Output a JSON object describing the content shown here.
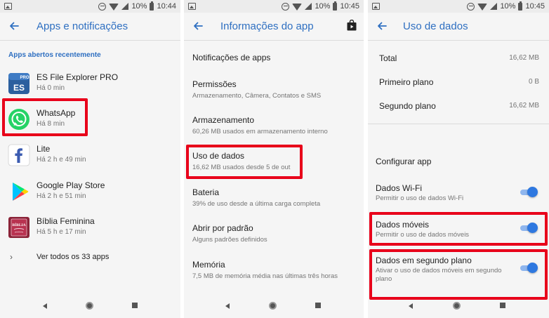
{
  "status_bar": {
    "screen1": {
      "battery": "10%",
      "time": "10:44"
    },
    "screen2": {
      "battery": "10%",
      "time": "10:45"
    },
    "screen3": {
      "battery": "10%",
      "time": "10:45"
    }
  },
  "screen1": {
    "title": "Apps e notificações",
    "section_header": "Apps abertos recentemente",
    "apps": [
      {
        "name": "ES File Explorer PRO",
        "time": "Há 0 min",
        "icon": "es-file-explorer-icon"
      },
      {
        "name": "WhatsApp",
        "time": "Há 8 min",
        "icon": "whatsapp-icon"
      },
      {
        "name": "Lite",
        "time": "Há 2 h e 49 min",
        "icon": "facebook-lite-icon"
      },
      {
        "name": "Google Play Store",
        "time": "Há 2 h e 51 min",
        "icon": "play-store-icon"
      },
      {
        "name": "Bíblia Feminina",
        "time": "Há 5 h e 17 min",
        "icon": "biblia-feminina-icon"
      }
    ],
    "see_all": "Ver todos os 33 apps",
    "icon_labels": {
      "es": "ES",
      "es_pro": "PRO",
      "biblia": "BÍBLIA"
    }
  },
  "screen2": {
    "title": "Informações do app",
    "items": [
      {
        "title": "Notificações de apps",
        "subtitle": ""
      },
      {
        "title": "Permissões",
        "subtitle": "Armazenamento, Câmera, Contatos e SMS"
      },
      {
        "title": "Armazenamento",
        "subtitle": "60,26 MB usados em armazenamento interno"
      },
      {
        "title": "Uso de dados",
        "subtitle": "16,62 MB usados desde 5 de out"
      },
      {
        "title": "Bateria",
        "subtitle": "39% de uso desde a última carga completa"
      },
      {
        "title": "Abrir por padrão",
        "subtitle": "Alguns padrões definidos"
      },
      {
        "title": "Memória",
        "subtitle": "7,5 MB de memória média nas últimas três horas"
      }
    ]
  },
  "screen3": {
    "title": "Uso de dados",
    "rows": [
      {
        "label": "Total",
        "value": "16,62 MB"
      },
      {
        "label": "Primeiro plano",
        "value": "0 B"
      },
      {
        "label": "Segundo plano",
        "value": "16,62 MB"
      }
    ],
    "config_header": "Configurar app",
    "toggles": [
      {
        "title": "Dados Wi-Fi",
        "subtitle": "Permitir o uso de dados Wi-Fi",
        "on": true
      },
      {
        "title": "Dados móveis",
        "subtitle": "Permitir o uso de dados móveis",
        "on": true
      },
      {
        "title": "Dados em segundo plano",
        "subtitle": "Ativar o uso de dados móveis em segundo plano",
        "on": true
      }
    ]
  },
  "colors": {
    "accent": "#2e6fc1",
    "highlight": "#e8001a",
    "switch_on": "#2e78e0",
    "whatsapp": "#25d366"
  }
}
